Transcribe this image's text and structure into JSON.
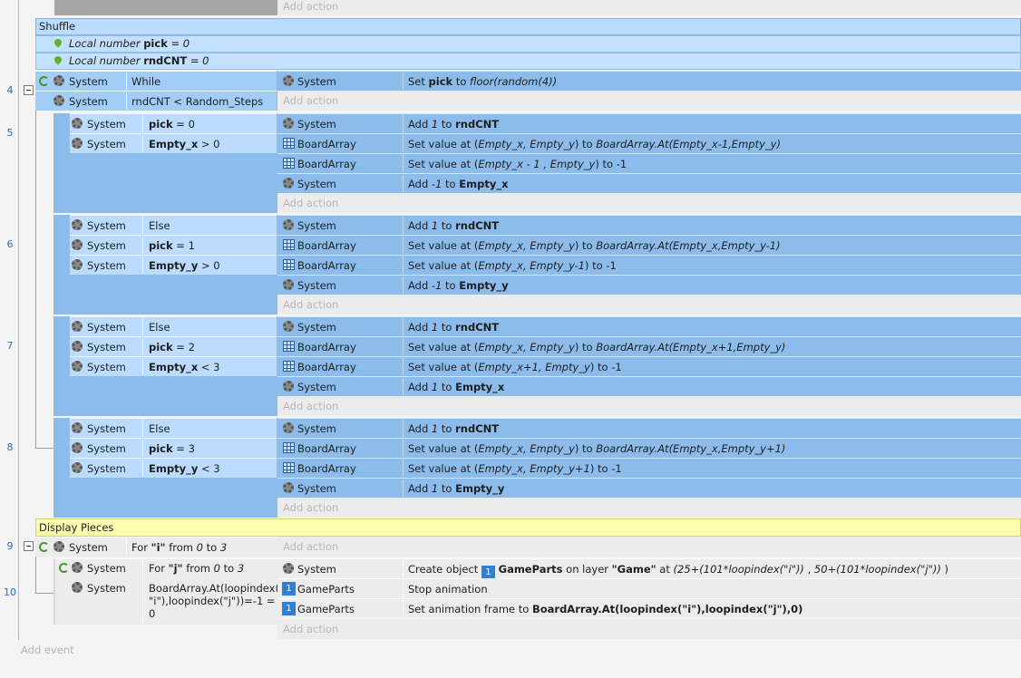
{
  "n": {
    "e4": "4",
    "e5": "5",
    "e6": "6",
    "e7": "7",
    "e8": "8",
    "e9": "9",
    "e10": "10"
  },
  "g": {
    "shuffle": "Shuffle",
    "display": "Display Pieces"
  },
  "v": {
    "pre": "Local number",
    "pick": "pick",
    "pv": "= 0",
    "rnd": "rndCNT",
    "rv": "= 0"
  },
  "t": {
    "sys": "System",
    "ba": "BoardArray",
    "gp": "GameParts",
    "add": "Add action",
    "addev": "Add event"
  },
  "c": {
    "while": "While",
    "rnd": "rndCNT < Random_Steps",
    "else": "Else",
    "pick": "pick",
    "p0": " = 0",
    "p1": " = 1",
    "p2": " = 2",
    "p3": " = 3",
    "ex": "Empty_x",
    "ey": "Empty_y",
    "gt0": " > 0",
    "lt3": " < 3",
    "for": "For ",
    "i": "\"i\"",
    "j": "\"j\"",
    "from": " from ",
    "zero": "0",
    "to": " to ",
    "three": "3",
    "baat": "BoardArray.At(loopindex(\n\"i\"),loopindex(\"j\"))=-1 =\n0"
  },
  "a": {
    "set": "Set ",
    "pick": "pick",
    "to": " to ",
    "floor": "floor(random(4))",
    "add": "Add ",
    "one": "1",
    "neg1": "-1",
    "rnd": "rndCNT",
    "ex": "Empty_x",
    "ey": "Empty_y",
    "sva": "Set value at (",
    "exey": "Empty_x, Empty_y",
    "close": ") to ",
    "m1": " to -1",
    "bax1": "BoardArray.At(Empty_x-1,Empty_y)",
    "xm1": "Empty_x - 1 , Empty_y",
    "bay1": "BoardArray.At(Empty_x,Empty_y-1)",
    "ym1": "Empty_x, Empty_y-1",
    "bax2": "BoardArray.At(Empty_x+1,Empty_y)",
    "xp1": "Empty_x+1, Empty_y",
    "bay2": "BoardArray.At(Empty_x,Empty_y+1)",
    "yp1": "Empty_x, Empty_y+1",
    "create": "Create object ",
    "badge": "1",
    "gp": "GameParts",
    "onl": " on layer ",
    "game": "\"Game\"",
    "at": " at ",
    "cx": "(25+(101*loopindex(\"i\"))",
    "comma": "  , ",
    "cy": "50+(101*loopindex(\"j\"))",
    "cend": "  )",
    "stop": "Stop animation",
    "saf": "Set animation frame to ",
    "frame": "BoardArray.At(loopindex(\"i\"),loopindex(\"j\"),0)"
  }
}
